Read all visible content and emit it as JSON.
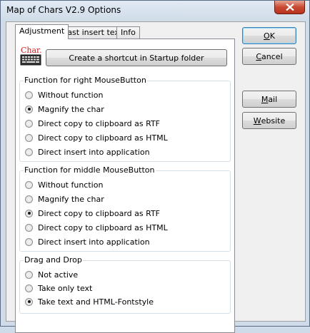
{
  "window": {
    "title": "Map of Chars V2.9 Options"
  },
  "tabs": [
    {
      "label": "Adjustment",
      "active": true
    },
    {
      "label": "Fast insert text",
      "active": false
    },
    {
      "label": "Info",
      "active": false
    }
  ],
  "shortcut": {
    "icon_text": "Char.",
    "label": "Create a shortcut in Startup folder"
  },
  "groups": {
    "right": {
      "title": "Function for right MouseButton",
      "options": [
        "Without function",
        "Magnify the char",
        "Direct copy to clipboard as RTF",
        "Direct copy to clipboard as HTML",
        "Direct insert into application"
      ],
      "selected": 1
    },
    "middle": {
      "title": "Function for middle MouseButton",
      "options": [
        "Without function",
        "Magnify the char",
        "Direct copy to clipboard as RTF",
        "Direct copy to clipboard as HTML",
        "Direct insert into application"
      ],
      "selected": 2
    },
    "dragdrop": {
      "title": "Drag and Drop",
      "options": [
        "Not active",
        "Take only text",
        "Take text and HTML-Fontstyle"
      ],
      "selected": 2
    }
  },
  "buttons": {
    "ok": {
      "label": "OK",
      "accel": "O",
      "rest": "K"
    },
    "cancel": {
      "label": "Cancel",
      "accel": "C",
      "rest": "ancel"
    },
    "mail": {
      "label": "Mail",
      "accel": "M",
      "rest": "ail"
    },
    "website": {
      "label": "Website",
      "accel": "W",
      "rest": "ebsite"
    }
  },
  "colors": {
    "close_button": "#c74a32",
    "icon_red": "#cc2222"
  }
}
